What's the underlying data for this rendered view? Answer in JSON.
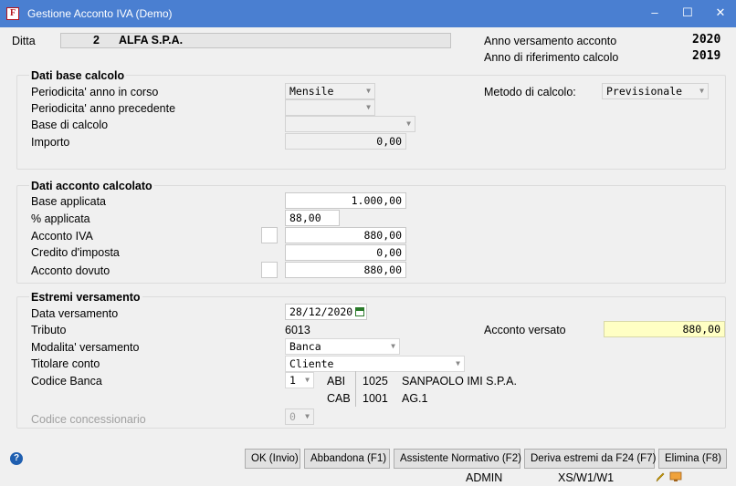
{
  "window": {
    "app_icon_letter": "F",
    "title": "Gestione Acconto IVA (Demo)",
    "minimize": "‒",
    "maximize": "☐",
    "close": "✕"
  },
  "header": {
    "ditta_label": "Ditta",
    "ditta_code": "2",
    "ditta_name": "ALFA S.P.A.",
    "anno_versamento_label": "Anno versamento acconto",
    "anno_versamento_value": "2020",
    "anno_riferimento_label": "Anno di riferimento calcolo",
    "anno_riferimento_value": "2019"
  },
  "dati_base": {
    "title": "Dati base calcolo",
    "periodicita_corso_label": "Periodicita' anno in corso",
    "periodicita_corso_value": "Mensile",
    "periodicita_prec_label": "Periodicita' anno precedente",
    "periodicita_prec_value": "",
    "base_calcolo_label": "Base di calcolo",
    "base_calcolo_value": "",
    "importo_label": "Importo",
    "importo_value": "0,00",
    "metodo_label": "Metodo di calcolo:",
    "metodo_value": "Previsionale"
  },
  "dati_acconto": {
    "title": "Dati acconto calcolato",
    "base_applicata_label": "Base applicata",
    "base_applicata_value": "1.000,00",
    "perc_applicata_label": "% applicata",
    "perc_applicata_value": "88,00",
    "acconto_iva_label": "Acconto IVA",
    "acconto_iva_value": "880,00",
    "credito_label": "Credito d'imposta",
    "credito_value": "0,00",
    "acconto_dovuto_label": "Acconto dovuto",
    "acconto_dovuto_value": "880,00"
  },
  "estremi": {
    "title": "Estremi versamento",
    "data_label": "Data versamento",
    "data_value": "28/12/2020",
    "tributo_label": "Tributo",
    "tributo_value": "6013",
    "acconto_versato_label": "Acconto versato",
    "acconto_versato_value": "880,00",
    "modalita_label": "Modalita' versamento",
    "modalita_value": "Banca",
    "titolare_label": "Titolare conto",
    "titolare_value": "Cliente",
    "codice_banca_label": "Codice Banca",
    "codice_banca_value": "1",
    "abi_label": "ABI",
    "abi_code": "1025",
    "abi_name": "SANPAOLO IMI S.P.A.",
    "cab_label": "CAB",
    "cab_code": "1001",
    "cab_name": "AG.1",
    "concessionario_label": "Codice concessionario",
    "concessionario_value": "0"
  },
  "buttons": {
    "ok": "OK (Invio)",
    "abbandona": "Abbandona (F1)",
    "assistente": "Assistente Normativo (F2)",
    "deriva": "Deriva estremi da F24 (F7)",
    "elimina": "Elimina (F8)"
  },
  "status": {
    "help_icon": "?",
    "user": "ADMIN",
    "terminal": "XS/W1/W1"
  },
  "colors": {
    "titlebar": "#4a7fd1",
    "highlight_field": "#ffffc4"
  }
}
